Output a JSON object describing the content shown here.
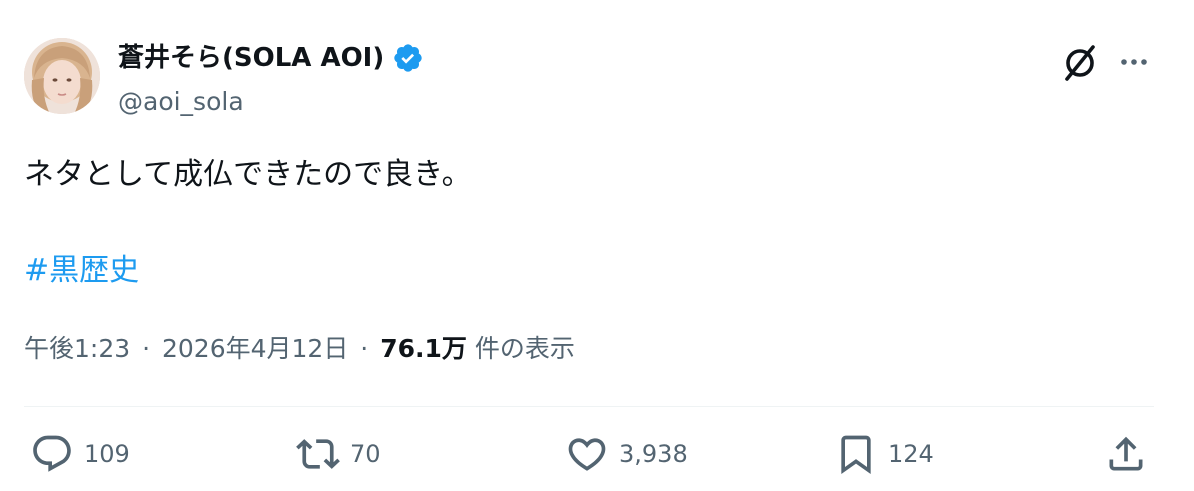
{
  "author": {
    "display_name": "蒼井そら(SOLA AOI)",
    "handle": "@aoi_sola",
    "verified": true,
    "verified_color": "#1d9bf0"
  },
  "tweet": {
    "text": "ネタとして成仏できたので良き。",
    "hashtag": "#黒歴史",
    "hashtag_color": "#1d9bf0"
  },
  "meta": {
    "time": "午後1:23",
    "separator": "·",
    "date": "2026年4月12日",
    "views_count": "76.1万",
    "views_label": "件の表示"
  },
  "actions": {
    "reply_count": "109",
    "retweet_count": "70",
    "like_count": "3,938",
    "bookmark_count": "124"
  },
  "icons": {
    "header": [
      "grok-icon",
      "more-icon"
    ],
    "actions": [
      "reply-icon",
      "retweet-icon",
      "like-icon",
      "bookmark-icon",
      "share-icon"
    ]
  }
}
